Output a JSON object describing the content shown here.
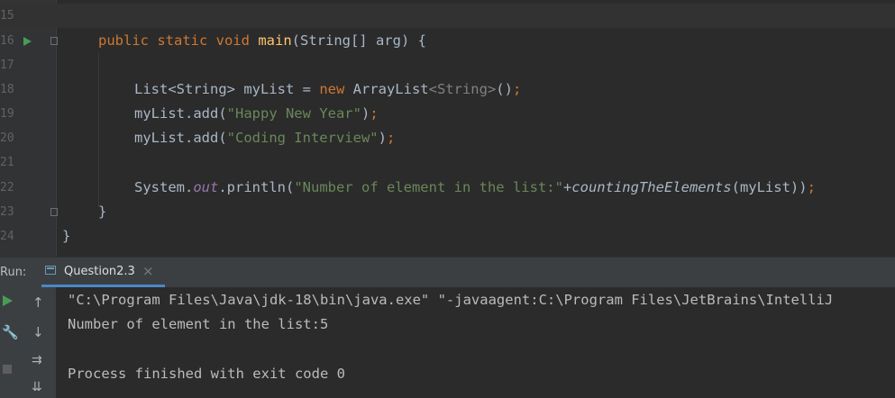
{
  "editor": {
    "lines": [
      {
        "num": "15"
      },
      {
        "num": "16",
        "run": true,
        "fold": true,
        "kw": "public static void",
        "fn": "main",
        "rest": "(String[] arg) {"
      },
      {
        "num": "17"
      },
      {
        "num": "18",
        "a": "List<String> myList = ",
        "kw": "new",
        "b": " ArrayList",
        "tp": "<String>",
        "c": "()",
        "semi": ";"
      },
      {
        "num": "19",
        "a": "myList.add(",
        "str": "\"Happy New Year\"",
        "b": ")",
        "semi": ";"
      },
      {
        "num": "20",
        "a": "myList.add(",
        "str": "\"Coding Interview\"",
        "b": ")",
        "semi": ";"
      },
      {
        "num": "21"
      },
      {
        "num": "22",
        "a": "System.",
        "fld": "out",
        "b": ".println(",
        "str": "\"Number of element in the list:\"",
        "c": "+",
        "sfn": "countingTheElements",
        "d": "(myList))",
        "semi": ";"
      },
      {
        "num": "23",
        "fold": true,
        "a": "}"
      },
      {
        "num": "24",
        "a": "}"
      }
    ]
  },
  "run_panel": {
    "label": "Run:",
    "tab_label": "Question2.3",
    "close_glyph": "×",
    "tools": {
      "run_icon": "play-icon",
      "up_icon": "arrow-up-icon",
      "down_icon": "arrow-down-icon",
      "wrench_icon": "wrench-icon",
      "wrap_icon": "soft-wrap-icon",
      "stop_icon": "stop-icon",
      "scroll_icon": "scroll-to-end-icon"
    },
    "output": [
      "\"C:\\Program Files\\Java\\jdk-18\\bin\\java.exe\" \"-javaagent:C:\\Program Files\\JetBrains\\IntelliJ",
      "Number of element in the list:5",
      "",
      "Process finished with exit code 0"
    ]
  },
  "colors": {
    "background": "#2b2b2b",
    "keyword": "#cc7832",
    "method": "#ffc66d",
    "string": "#6a8759",
    "field": "#9876aa",
    "text": "#a9b7c6",
    "run_green": "#499c54"
  }
}
